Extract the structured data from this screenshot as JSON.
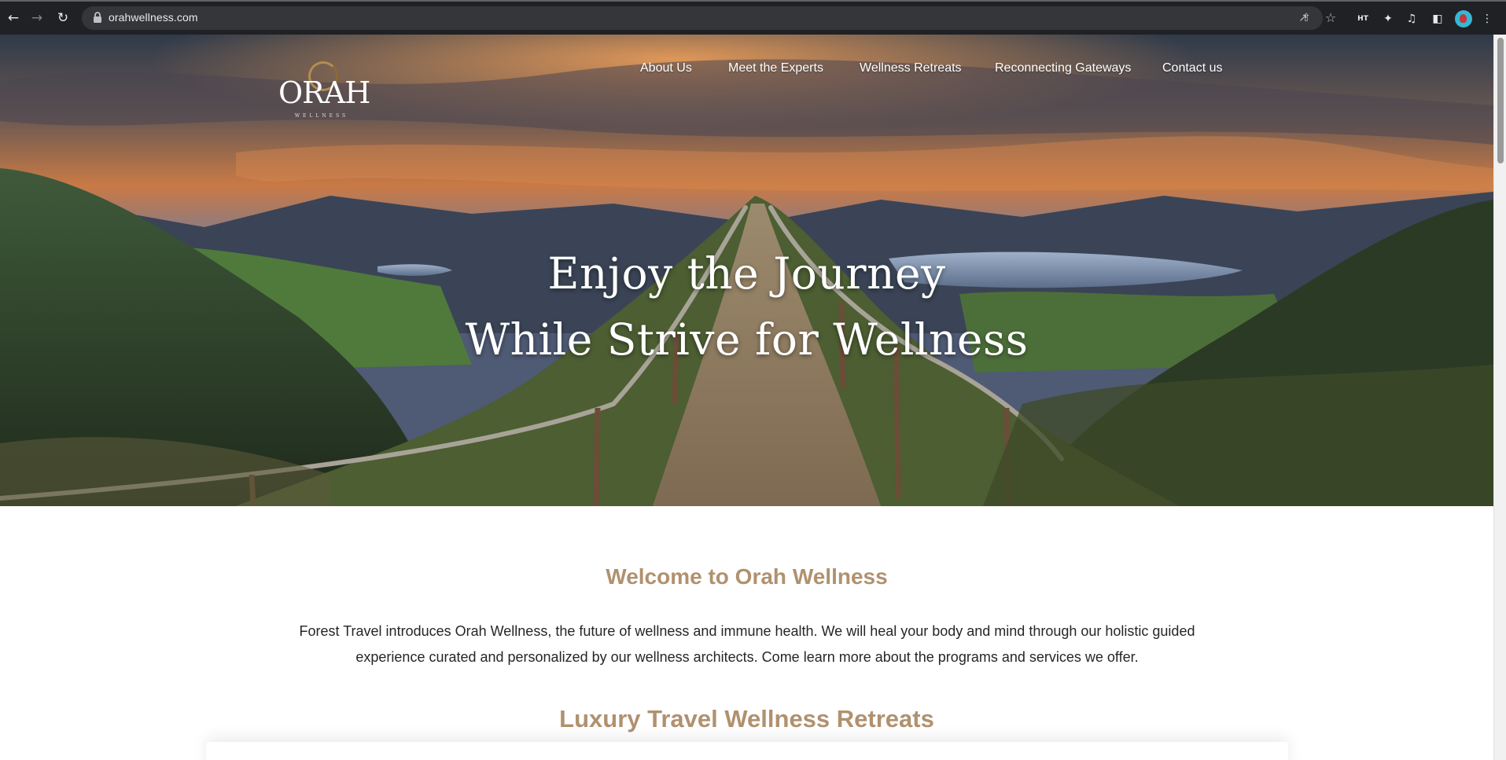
{
  "browser": {
    "url": "orahwellness.com",
    "icons": {
      "back": "arrow-left-icon",
      "forward": "arrow-right-icon",
      "reload": "reload-icon",
      "lock": "lock-icon",
      "share": "share-icon",
      "bookmark": "star-icon",
      "extensions": "puzzle-icon",
      "media": "media-control-icon",
      "sidepanel": "side-panel-icon",
      "menu": "kebab-menu-icon"
    },
    "extension_ht_label": "HT"
  },
  "site": {
    "logo": {
      "word": "ORAH",
      "sub": "WELLNESS"
    },
    "nav": [
      {
        "label": "About Us"
      },
      {
        "label": "Meet the Experts"
      },
      {
        "label": "Wellness Retreats"
      },
      {
        "label": "Reconnecting Gateways"
      },
      {
        "label": "Contact us"
      }
    ],
    "hero": {
      "line1": "Enjoy the Journey",
      "line2": "While Strive for Wellness"
    },
    "welcome": {
      "heading": "Welcome to Orah Wellness",
      "body": "Forest Travel introduces Orah Wellness, the future of wellness and immune health. We will heal your body and mind through our holistic guided experience curated and personalized by our wellness architects. Come learn more about the programs and services we offer."
    },
    "retreats_heading": "Luxury Travel Wellness Retreats"
  },
  "colors": {
    "accent": "#b0916f",
    "logo_gold": "#b48d4f",
    "chrome_bg": "#202124"
  }
}
